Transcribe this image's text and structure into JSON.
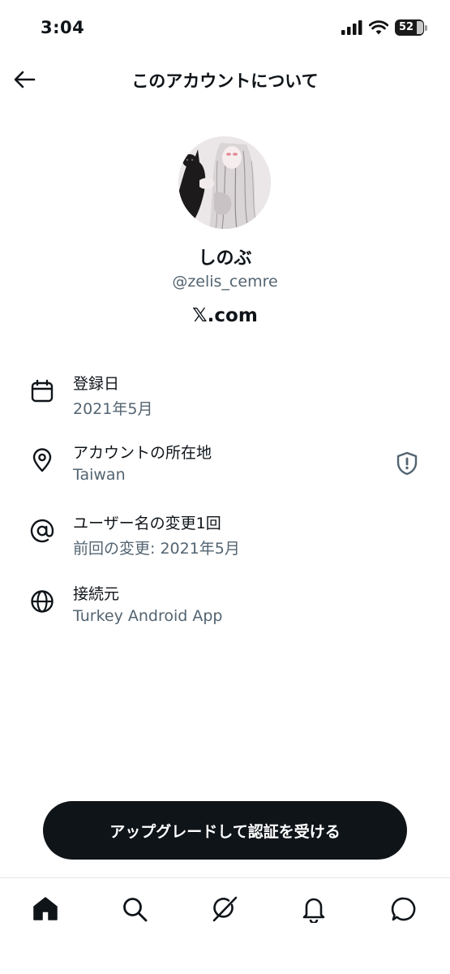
{
  "status_bar": {
    "time": "3:04",
    "battery": "52"
  },
  "header": {
    "title": "このアカウントについて"
  },
  "profile": {
    "display_name": "しのぶ",
    "handle": "@zelis_cemre",
    "site": "𝕏.com"
  },
  "info": [
    {
      "icon": "calendar-icon",
      "label": "登録日",
      "value": "2021年5月"
    },
    {
      "icon": "location-pin-icon",
      "label": "アカウントの所在地",
      "value": "Taiwan"
    },
    {
      "icon": "at-sign-icon",
      "label": "ユーザー名の変更1回",
      "value": "前回の変更: 2021年5月"
    },
    {
      "icon": "globe-icon",
      "label": "接続元",
      "value": "Turkey Android App"
    }
  ],
  "upgrade_button": {
    "label": "アップグレードして認証を受ける"
  },
  "bottom_nav": [
    "home-icon",
    "search-icon",
    "grok-icon",
    "bell-icon",
    "messages-icon"
  ],
  "colors": {
    "text": "#0f1419",
    "secondary": "#536471",
    "button_bg": "#0f1419",
    "divider": "#e1e5e9"
  }
}
